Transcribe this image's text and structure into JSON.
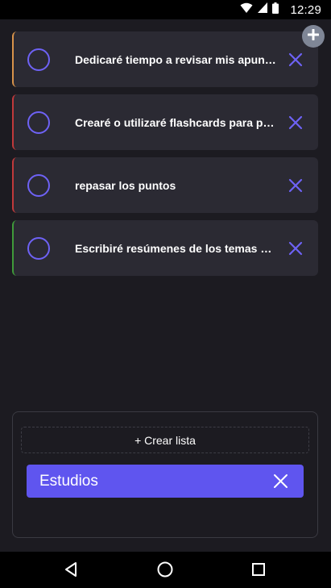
{
  "status_bar": {
    "time": "12:29",
    "icons": [
      "wifi-icon",
      "signal-icon",
      "battery-icon"
    ]
  },
  "header": {
    "add_icon": "plus-icon"
  },
  "tasks": [
    {
      "text": "Dedicaré tiempo a revisar mis apuntes de clase",
      "accent": "#d8934a"
    },
    {
      "text": "Crearé o utilizaré flashcards para preguntas clave",
      "accent": "#c0393b"
    },
    {
      "text": "repasar los puntos",
      "accent": "#c0393b"
    },
    {
      "text": "Escribiré resúmenes de los temas más importantes",
      "accent": "#3f9a3a"
    }
  ],
  "lists_panel": {
    "create_label": "+ Crear lista",
    "lists": [
      {
        "name": "Estudios"
      }
    ]
  },
  "nav_bar": {
    "icons": [
      "back-icon",
      "home-icon",
      "recents-icon"
    ]
  },
  "colors": {
    "background": "#1c1b21",
    "card": "#2b2a33",
    "accent": "#6e62f5",
    "chip": "#5f55ef"
  }
}
